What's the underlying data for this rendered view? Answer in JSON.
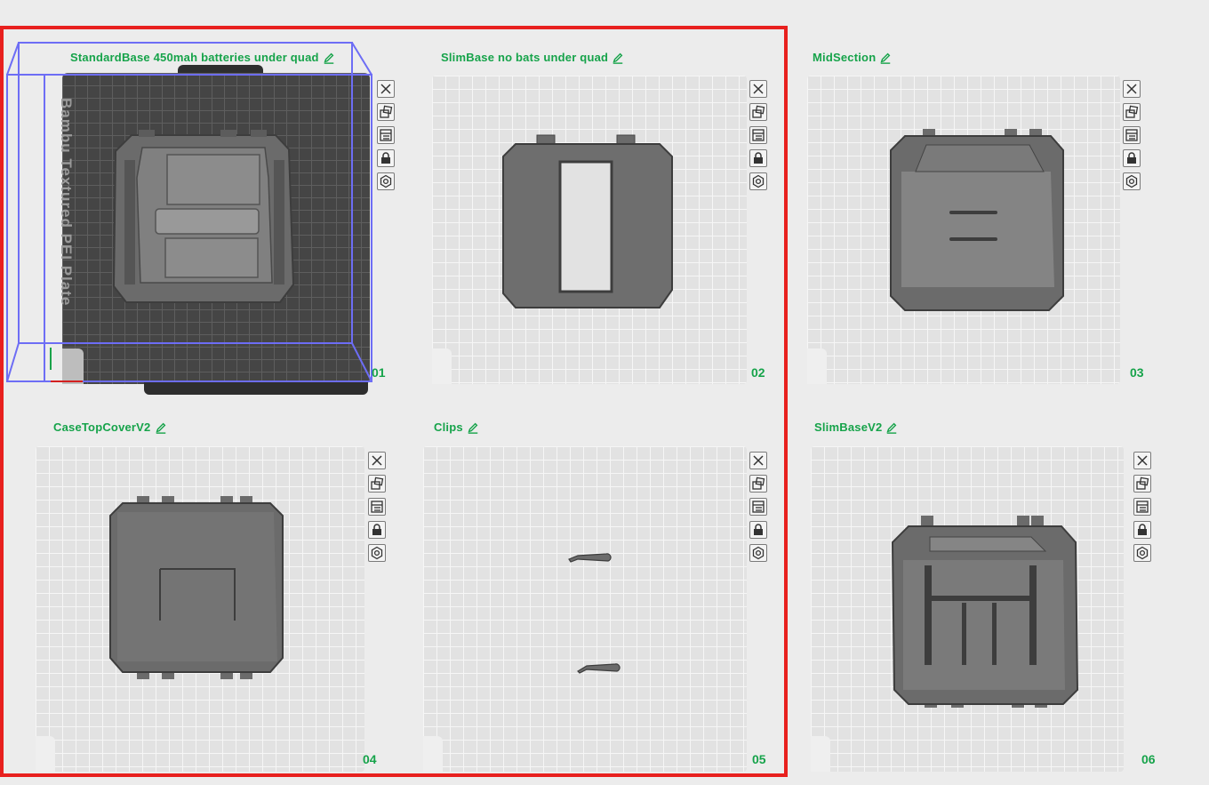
{
  "plates": [
    {
      "name": "StandardBase 450mah batteries under quad",
      "number": "01",
      "bed_label": "Bambu Textured PEI Plate"
    },
    {
      "name": "SlimBase no bats under quad",
      "number": "02"
    },
    {
      "name": "MidSection",
      "number": "03"
    },
    {
      "name": "CaseTopCoverV2",
      "number": "04"
    },
    {
      "name": "Clips",
      "number": "05"
    },
    {
      "name": "SlimBaseV2",
      "number": "06"
    }
  ],
  "toolbar_icons": [
    "close-icon",
    "auto-arrange-icon",
    "orient-icon",
    "lock-icon",
    "settings-icon"
  ],
  "colors": {
    "accent_green": "#16a34a",
    "selection_red": "#e8201e",
    "model_gray": "#6b6b6b"
  }
}
